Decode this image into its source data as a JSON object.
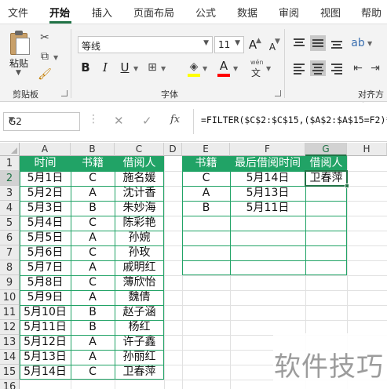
{
  "ribbon_tabs": [
    "文件",
    "开始",
    "插入",
    "页面布局",
    "公式",
    "数据",
    "审阅",
    "视图",
    "帮助"
  ],
  "active_tab": "开始",
  "ribbon": {
    "clipboard": {
      "paste_label": "粘贴",
      "group_label": "剪贴板"
    },
    "font": {
      "font_name": "等线",
      "font_size": "11",
      "grow_label": "A",
      "shrink_label": "A",
      "bold": "B",
      "italic": "I",
      "underline": "U",
      "phonetic": "wén",
      "font_color_label": "A",
      "group_label": "字体"
    },
    "alignment": {
      "group_label": "对齐方式"
    }
  },
  "colors": {
    "accent": "#217346",
    "table_header": "#21a366",
    "highlight": "#ffff00",
    "font_color": "#ff0000"
  },
  "formula_bar": {
    "cell_ref": "G2",
    "cancel_icon": "✕",
    "enter_icon": "✓",
    "fx_label": "fx",
    "formula": "=FILTER($C$2:$C$15,($A$2:$A$15=F2)*("
  },
  "grid": {
    "columns": [
      "A",
      "B",
      "C",
      "D",
      "E",
      "F",
      "G",
      "H"
    ],
    "rows": [
      "1",
      "2",
      "3",
      "4",
      "5",
      "6",
      "7",
      "8",
      "9",
      "10",
      "11",
      "12",
      "13",
      "14",
      "15",
      "16"
    ],
    "selected_column": "G",
    "selected_row": "2",
    "left_table": {
      "headers": [
        "时间",
        "书籍",
        "借阅人"
      ],
      "rows": [
        [
          "5月1日",
          "C",
          "施名媛"
        ],
        [
          "5月2日",
          "A",
          "沈计香"
        ],
        [
          "5月3日",
          "B",
          "朱妙海"
        ],
        [
          "5月4日",
          "C",
          "陈彩艳"
        ],
        [
          "5月5日",
          "A",
          "孙婉"
        ],
        [
          "5月6日",
          "C",
          "孙玫"
        ],
        [
          "5月7日",
          "A",
          "戚明红"
        ],
        [
          "5月8日",
          "C",
          "薄欣怡"
        ],
        [
          "5月9日",
          "A",
          "魏倩"
        ],
        [
          "5月10日",
          "B",
          "赵子涵"
        ],
        [
          "5月11日",
          "B",
          "杨红"
        ],
        [
          "5月12日",
          "A",
          "许子鑫"
        ],
        [
          "5月13日",
          "A",
          "孙丽红"
        ],
        [
          "5月14日",
          "C",
          "卫春萍"
        ]
      ]
    },
    "right_table": {
      "headers": [
        "书籍",
        "最后借阅时间",
        "借阅人"
      ],
      "rows": [
        [
          "C",
          "5月14日",
          "卫春萍"
        ],
        [
          "A",
          "5月13日",
          ""
        ],
        [
          "B",
          "5月11日",
          ""
        ],
        [
          "",
          "",
          ""
        ],
        [
          "",
          "",
          ""
        ],
        [
          "",
          "",
          ""
        ],
        [
          "",
          "",
          ""
        ]
      ]
    }
  },
  "watermark": "软件技巧"
}
